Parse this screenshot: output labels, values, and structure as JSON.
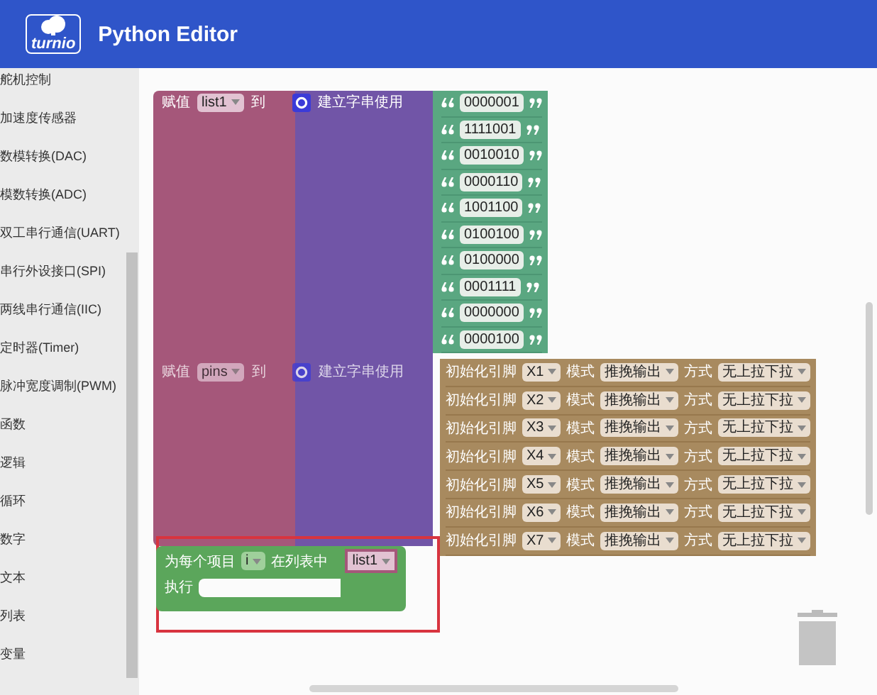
{
  "header": {
    "logo_text": "turnio",
    "title": "Python Editor"
  },
  "sidebar": {
    "items": [
      {
        "label": "舵机控制"
      },
      {
        "label": "加速度传感器"
      },
      {
        "label": "数模转换(DAC)"
      },
      {
        "label": "模数转换(ADC)"
      },
      {
        "label": "双工串行通信(UART)"
      },
      {
        "label": "串行外设接口(SPI)"
      },
      {
        "label": "两线串行通信(IIC)"
      },
      {
        "label": "定时器(Timer)"
      },
      {
        "label": "脉冲宽度调制(PWM)"
      },
      {
        "label": "函数"
      },
      {
        "label": "逻辑"
      },
      {
        "label": "循环"
      },
      {
        "label": "数字"
      },
      {
        "label": "文本"
      },
      {
        "label": "列表"
      },
      {
        "label": "变量"
      }
    ]
  },
  "workspace": {
    "assign_list": {
      "keyword": "赋值",
      "variable": "list1",
      "to": "到",
      "builder": "建立字串使用",
      "strings": [
        "0000001",
        "1111001",
        "0010010",
        "0000110",
        "1001100",
        "0100100",
        "0100000",
        "0001111",
        "0000000",
        "0000100"
      ]
    },
    "assign_pins": {
      "keyword": "赋值",
      "variable": "pins",
      "to": "到",
      "builder": "建立字串使用",
      "rows": [
        {
          "label": "初始化引脚",
          "pin": "X1",
          "mode_label": "模式",
          "mode": "推挽输出",
          "pull_label": "方式",
          "pull": "无上拉下拉"
        },
        {
          "label": "初始化引脚",
          "pin": "X2",
          "mode_label": "模式",
          "mode": "推挽输出",
          "pull_label": "方式",
          "pull": "无上拉下拉"
        },
        {
          "label": "初始化引脚",
          "pin": "X3",
          "mode_label": "模式",
          "mode": "推挽输出",
          "pull_label": "方式",
          "pull": "无上拉下拉"
        },
        {
          "label": "初始化引脚",
          "pin": "X4",
          "mode_label": "模式",
          "mode": "推挽输出",
          "pull_label": "方式",
          "pull": "无上拉下拉"
        },
        {
          "label": "初始化引脚",
          "pin": "X5",
          "mode_label": "模式",
          "mode": "推挽输出",
          "pull_label": "方式",
          "pull": "无上拉下拉"
        },
        {
          "label": "初始化引脚",
          "pin": "X6",
          "mode_label": "模式",
          "mode": "推挽输出",
          "pull_label": "方式",
          "pull": "无上拉下拉"
        },
        {
          "label": "初始化引脚",
          "pin": "X7",
          "mode_label": "模式",
          "mode": "推挽输出",
          "pull_label": "方式",
          "pull": "无上拉下拉"
        }
      ]
    },
    "for_each": {
      "label": "为每个项目",
      "variable": "i",
      "in_list": "在列表中",
      "list": "list1",
      "do": "执行"
    }
  }
}
